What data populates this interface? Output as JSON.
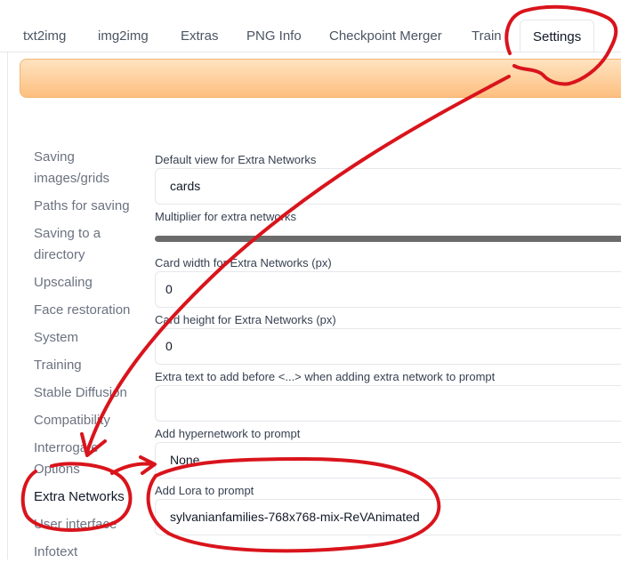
{
  "tabs": [
    {
      "label": "txt2img"
    },
    {
      "label": "img2img"
    },
    {
      "label": "Extras"
    },
    {
      "label": "PNG Info"
    },
    {
      "label": "Checkpoint Merger"
    },
    {
      "label": "Train"
    },
    {
      "label": "Settings",
      "active": true
    }
  ],
  "sidebar": {
    "items": [
      {
        "label": "Saving images/grids"
      },
      {
        "label": "Paths for saving"
      },
      {
        "label": "Saving to a directory"
      },
      {
        "label": "Upscaling"
      },
      {
        "label": "Face restoration"
      },
      {
        "label": "System"
      },
      {
        "label": "Training"
      },
      {
        "label": "Stable Diffusion"
      },
      {
        "label": "Compatibility"
      },
      {
        "label": "Interrogate Options"
      },
      {
        "label": "Extra Networks",
        "active": true
      },
      {
        "label": "User interface"
      },
      {
        "label": "Infotext"
      }
    ]
  },
  "settings": {
    "default_view": {
      "label": "Default view for Extra Networks",
      "value": "cards"
    },
    "multiplier": {
      "label": "Multiplier for extra networks"
    },
    "card_width": {
      "label": "Card width for Extra Networks (px)",
      "value": "0"
    },
    "card_height": {
      "label": "Card height for Extra Networks (px)",
      "value": "0"
    },
    "extra_text": {
      "label": "Extra text to add before <...> when adding extra network to prompt",
      "value": ""
    },
    "add_hypernetwork": {
      "label": "Add hypernetwork to prompt",
      "value": "None"
    },
    "add_lora": {
      "label": "Add Lora to prompt",
      "value": "sylvanianfamilies-768x768-mix-ReVAnimated"
    }
  },
  "colors": {
    "annotation": "#d9141c",
    "orange_bar": "#fdbf7f"
  }
}
